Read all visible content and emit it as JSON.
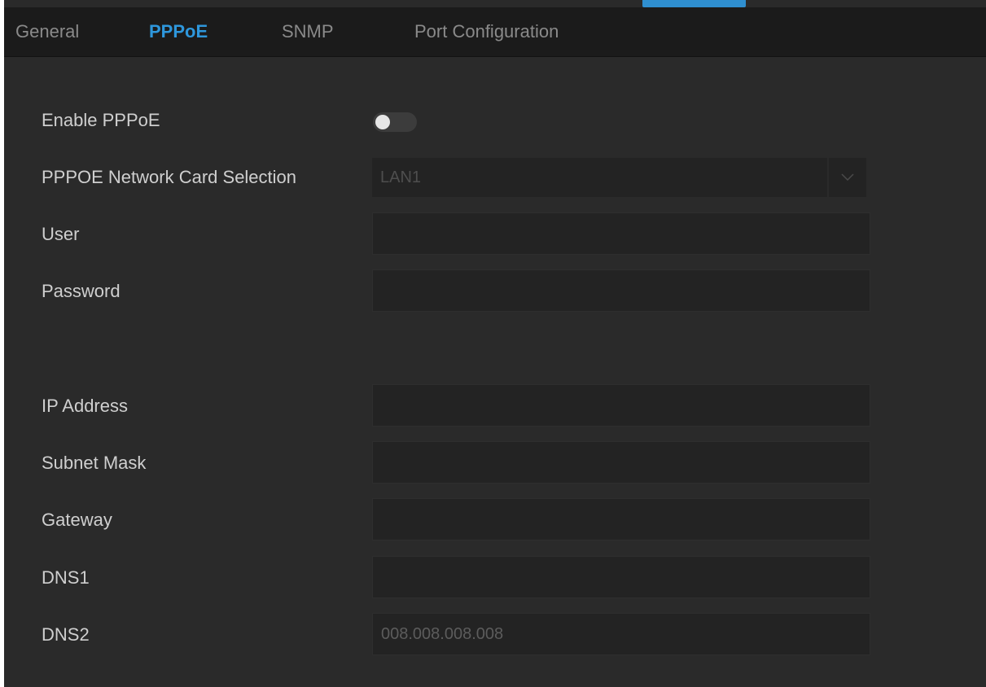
{
  "tabs": {
    "general": "General",
    "pppoe": "PPPoE",
    "snmp": "SNMP",
    "port_configuration": "Port Configuration"
  },
  "active_tab": "PPPoE",
  "form": {
    "enable_pppoe": {
      "label": "Enable PPPoE",
      "enabled": false
    },
    "network_card": {
      "label": "PPPOE Network Card Selection",
      "value": "LAN1"
    },
    "user": {
      "label": "User",
      "value": ""
    },
    "password": {
      "label": "Password",
      "value": ""
    },
    "ip_address": {
      "label": "IP Address",
      "value": ""
    },
    "subnet_mask": {
      "label": "Subnet Mask",
      "value": ""
    },
    "gateway": {
      "label": "Gateway",
      "value": ""
    },
    "dns1": {
      "label": "DNS1",
      "value": ""
    },
    "dns2": {
      "label": "DNS2",
      "value": "008.008.008.008"
    }
  },
  "icons": {
    "dropdown": "chevron-down-icon"
  },
  "colors": {
    "accent": "#2e97dc",
    "background": "#2a2a2a",
    "tab_bar": "#1b1b1b",
    "field": "#232323",
    "label_text": "#cfcfcf",
    "inactive_tab_text": "#8a8a8a"
  }
}
